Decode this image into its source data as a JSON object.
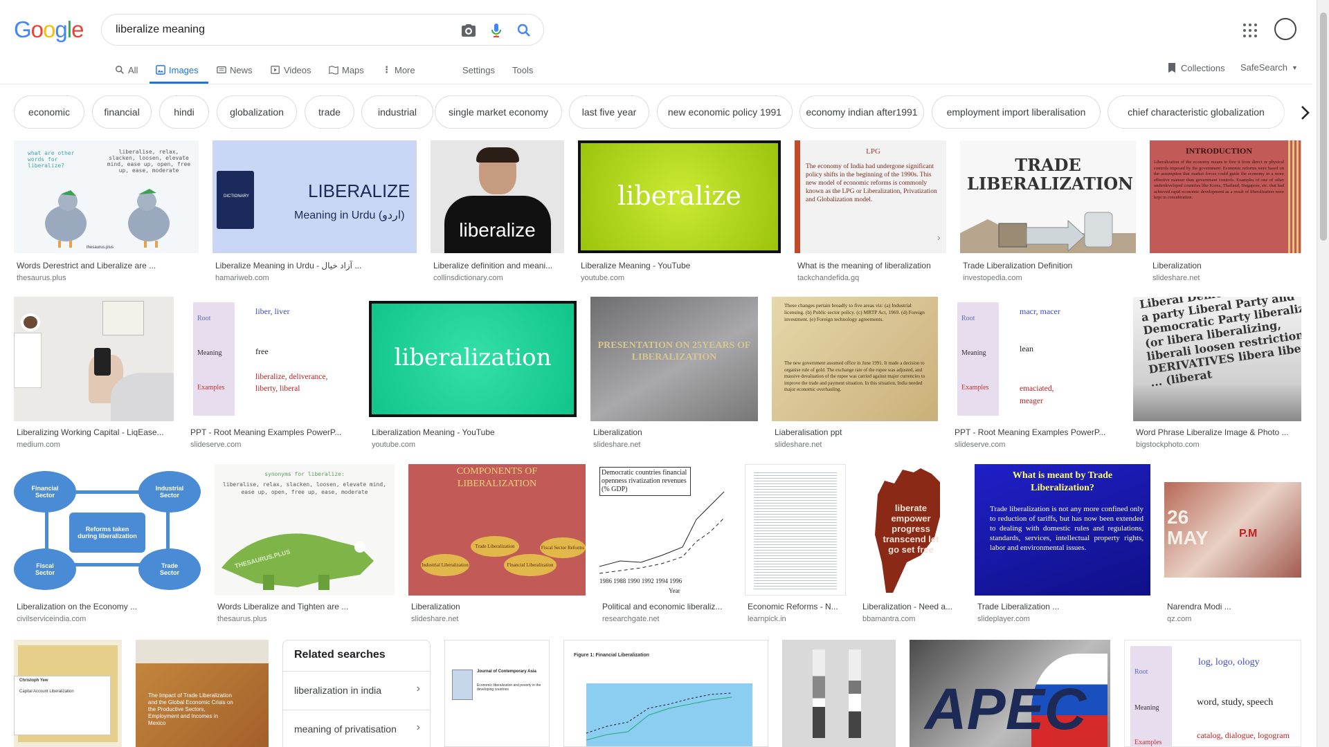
{
  "logo": [
    "G",
    "o",
    "o",
    "g",
    "l",
    "e"
  ],
  "search": {
    "query": "liberalize meaning"
  },
  "tabs": [
    {
      "label": "All"
    },
    {
      "label": "Images"
    },
    {
      "label": "News"
    },
    {
      "label": "Videos"
    },
    {
      "label": "Maps"
    },
    {
      "label": "More"
    },
    {
      "label": "Settings"
    },
    {
      "label": "Tools"
    }
  ],
  "right_tools": {
    "collections": "Collections",
    "safesearch": "SafeSearch"
  },
  "chips": [
    "economic",
    "financial",
    "hindi",
    "globalization",
    "trade",
    "industrial",
    "single market economy",
    "last five year",
    "new economic policy 1991",
    "economy indian after1991",
    "employment import liberalisation",
    "chief characteristic globalization"
  ],
  "results": [
    {
      "caption": "Words Derestrict and Liberalize are ...",
      "source": "thesaurus.plus",
      "img_text": "what are other words for liberalize?",
      "img_text2": "liberalise, relax, slacken, loosen, elevate mind, ease up, open, free up, ease, moderate",
      "img_text3": "thesaurus.plus"
    },
    {
      "caption": "Liberalize Meaning in Urdu - آزاد خیال ...",
      "source": "hamariweb.com",
      "img_text": "LIBERALIZE",
      "img_text2": "Meaning in Urdu (اردو)",
      "img_text3": "DICTIONARY"
    },
    {
      "caption": "Liberalize definition and meani...",
      "source": "collinsdictionary.com",
      "img_text": "liberalize"
    },
    {
      "caption": "Liberalize Meaning - YouTube",
      "source": "youtube.com",
      "img_text": "liberalize"
    },
    {
      "caption": "What is the meaning of liberalization",
      "source": "tackchandefida.gq",
      "img_text": "LPG",
      "img_text2": "The economy of India had undergone significant policy shifts in the beginning of the 1990s. This new model of economic reforms is commonly known as the LPG or Liberalization, Privatization and Globalization model."
    },
    {
      "caption": "Trade Liberalization Definition",
      "source": "investopedia.com",
      "img_text": "TRADE LIBERALIZATION"
    },
    {
      "caption": "Liberalization",
      "source": "slideshare.net",
      "img_text": "INTRODUCTION",
      "img_text2": "Liberalization of the economy means to free it from direct or physical controls imposed by the government. Economic reforms were based on the assumption that market forces could guide the economy in a more effective manner than government controls. Examples of one of other underdeveloped countries like Korea, Thailand, Singapore, etc. that had achieved rapid economic development as a result of liberalization were kept in consideration."
    },
    {
      "caption": "Liberalizing Working Capital - LiqEase...",
      "source": "medium.com"
    },
    {
      "caption": "PPT - Root Meaning Examples PowerP...",
      "source": "slideserve.com",
      "img_text": "Root",
      "img_text2": "Meaning",
      "img_text3": "Examples",
      "img_text4": "liber, liver",
      "img_text5": "free",
      "img_text6": "liberalize, deliverance, liberty, liberal"
    },
    {
      "caption": "Liberalization Meaning - YouTube",
      "source": "youtube.com",
      "img_text": "liberalization"
    },
    {
      "caption": "Liberalization",
      "source": "slideshare.net",
      "img_text": "PRESENTATION ON 25YEARS OF LIBERALIZATION"
    },
    {
      "caption": "Liaberalisation ppt",
      "source": "slideshare.net",
      "img_text": "These changes pertain broadly to five areas viz: (a) Industrial licensing. (b) Public sector policy. (c) MRTP Act, 1969. (d) Foreign investment. (e) Foreign technology agreements.",
      "img_text2": "The new government assumed office in June 1991. It made a decision to organise rule of gold. The exchange rate of the rupee was adjusted, and massive devaluation of the rupee was carried against major currencies to improve the trade and payment situation. In this situation, India needed major economic overhauling."
    },
    {
      "caption": "PPT - Root Meaning Examples PowerP...",
      "source": "slideserve.com",
      "img_text": "Root",
      "img_text2": "Meaning",
      "img_text3": "Examples",
      "img_text4": "macr, macer",
      "img_text5": "lean",
      "img_text6": "emaciated, meager"
    },
    {
      "caption": "Word Phrase Liberalize Image & Photo ...",
      "source": "bigstockphoto.com",
      "img_text": "Liberal Democrat member of a party Liberal Party and Democratic Party liberalize (or libera liberalizing, liberali loosen restrictions - DERIVATIVES libera liberate ... (liberat"
    },
    {
      "caption": "Liberalization on the Economy ...",
      "source": "civilserviceindia.com",
      "img_text": "Financial Sector",
      "img_text2": "Industrial Sector",
      "img_text3": "Reforms taken during liberalization",
      "img_text4": "Fiscal Sector",
      "img_text5": "Trade Sector"
    },
    {
      "caption": "Words Liberalize and Tighten are ...",
      "source": "thesaurus.plus",
      "img_text": "synonyms for liberalize:",
      "img_text2": "liberalise, relax, slacken, loosen, elevate mind, ease up, open, free up, ease, moderate",
      "img_text3": "THESAURUS.PLUS"
    },
    {
      "caption": "Liberalization",
      "source": "slideshare.net",
      "img_text": "COMPONENTS OF LIBERALIZATION",
      "img_text2": "Trade Liberalization",
      "img_text3": "Fiscal Sector Reforms",
      "img_text4": "Industrial Liberalization",
      "img_text5": "Financial Liberalization"
    },
    {
      "caption": "Political and economic liberaliz...",
      "source": "researchgate.net",
      "img_text": "Democratic countries financial openness rivatization revenues (% GDP)",
      "img_text2": "1986 1988 1990 1992 1994 1996",
      "img_text3": "Year"
    },
    {
      "caption": "Economic Reforms - N...",
      "source": "learnpick.in"
    },
    {
      "caption": "Liberalization - Need a...",
      "source": "bbamantra.com",
      "img_text": "liberate empower progress transcend let go set free"
    },
    {
      "caption": "Trade Liberalization ...",
      "source": "slideplayer.com",
      "img_text": "What is meant by Trade Liberalization?",
      "img_text2": "Trade liberalization is not any more confined only to reduction of tariffs, but has now been extended to dealing with domestic rules and regulations, standards, services, intellectual property rights, labor and environmental issues."
    },
    {
      "caption": "Narendra Modi ...",
      "source": "qz.com",
      "img_text": "26 MAY",
      "img_text2": "P.M"
    },
    {
      "img_text": "Christoph Yew",
      "img_text2": "Capital Account Liberalization"
    },
    {
      "img_text": "The Impact of Trade Liberalization and the Global Economic Crisis on the Productive Sectors, Employment and Incomes in Mexico"
    },
    {
      "img_text": "Journal of Contemporary Asia",
      "img_text2": "Economic liberalization and poverty in the developing countries"
    },
    {
      "img_text": "Figure 1: Financial Liberalization"
    },
    {},
    {
      "img_text": "APEC"
    },
    {
      "img_text": "Root",
      "img_text2": "Meaning",
      "img_text3": "Examples",
      "img_text4": "log, logo, ology",
      "img_text5": "word, study, speech",
      "img_text6": "catalog, dialogue, logogram"
    }
  ],
  "related": {
    "title": "Related searches",
    "items": [
      "liberalization in india",
      "meaning of privatisation"
    ]
  },
  "colors": {
    "accent": "#1a73e8",
    "chip_border": "#dadce0",
    "caption": "#3c4043",
    "source": "#70757a"
  }
}
